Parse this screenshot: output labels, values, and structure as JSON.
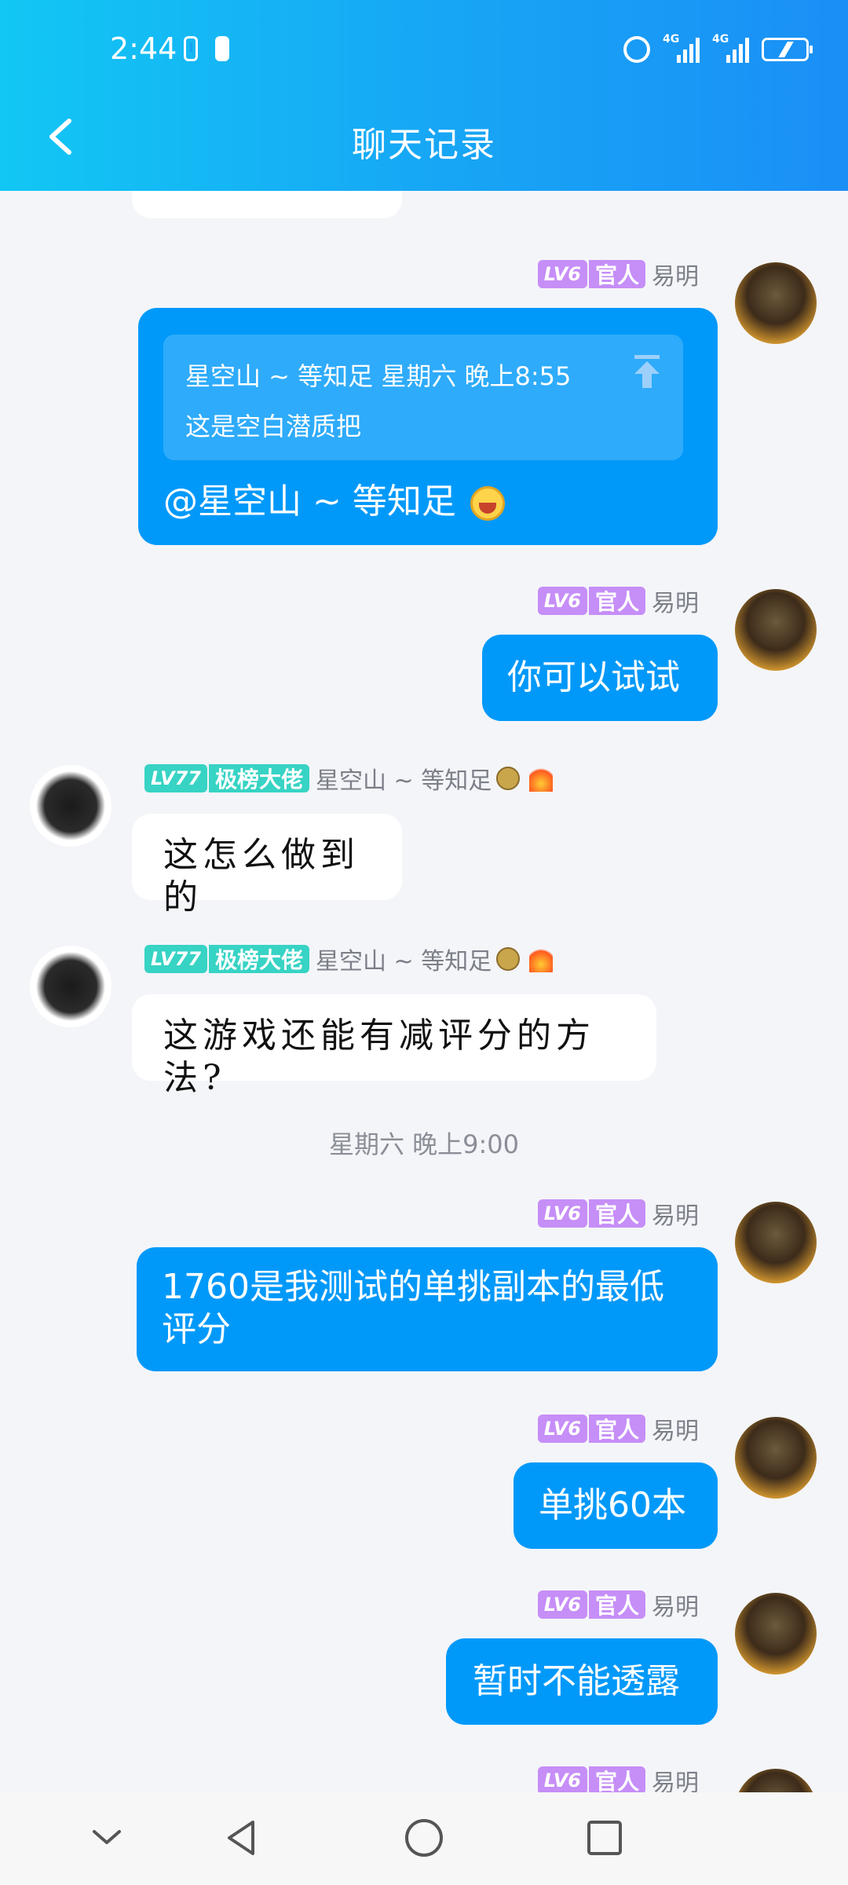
{
  "status_bar": {
    "time": "2:44",
    "network_label": "4G"
  },
  "header": {
    "title": "聊天记录"
  },
  "messages": {
    "m1": {
      "level": "LV6",
      "title": "官人",
      "name": "易明",
      "quote_header": "星空山 ~ 等知足 星期六 晚上8:55",
      "quote_body": "这是空白潜质把",
      "text": "@星空山 ~ 等知足"
    },
    "m2": {
      "level": "LV6",
      "title": "官人",
      "name": "易明",
      "text": "你可以试试"
    },
    "m3": {
      "level": "LV77",
      "title": "极榜大佬",
      "name": "星空山 ~ 等知足",
      "text": "这怎么做到的"
    },
    "m4": {
      "level": "LV77",
      "title": "极榜大佬",
      "name": "星空山 ~ 等知足",
      "text": "这游戏还能有减评分的方法?"
    },
    "ts1": "星期六 晚上9:00",
    "m5": {
      "level": "LV6",
      "title": "官人",
      "name": "易明",
      "text": "1760是我测试的单挑副本的最低评分"
    },
    "m6": {
      "level": "LV6",
      "title": "官人",
      "name": "易明",
      "text": "单挑60本"
    },
    "m7": {
      "level": "LV6",
      "title": "官人",
      "name": "易明",
      "text": "暂时不能透露"
    },
    "m8": {
      "level": "LV6",
      "title": "官人",
      "name": "易明"
    }
  },
  "colors": {
    "header": "#17a7f5",
    "bubble_out": "#0199f9",
    "lv_me": "#c68ef7",
    "lv_other": "#37d3c4"
  }
}
